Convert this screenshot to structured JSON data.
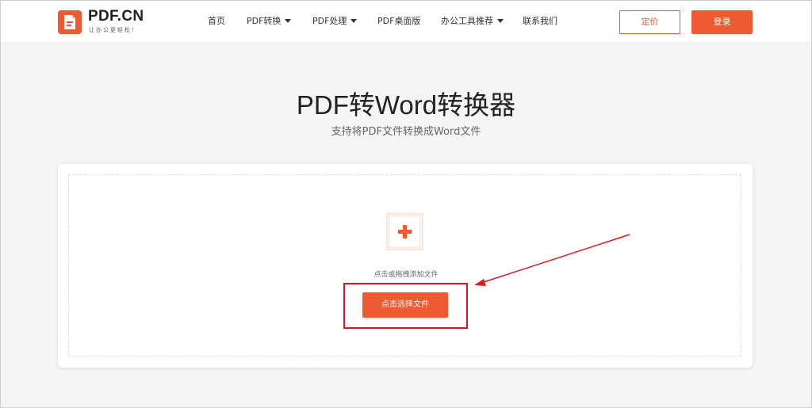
{
  "header": {
    "brand": "PDF.CN",
    "slogan": "让办公更轻松！",
    "logo_icon": "pdf-document-icon",
    "nav": [
      {
        "label": "首页",
        "has_dropdown": false
      },
      {
        "label": "PDF转换",
        "has_dropdown": true
      },
      {
        "label": "PDF处理",
        "has_dropdown": true
      },
      {
        "label": "PDF桌面版",
        "has_dropdown": false
      },
      {
        "label": "办公工具推荐",
        "has_dropdown": true
      },
      {
        "label": "联系我们",
        "has_dropdown": false
      }
    ],
    "price_button": "定价",
    "login_button": "登录"
  },
  "main": {
    "title": "PDF转Word转换器",
    "subtitle": "支持将PDF文件转换成Word文件",
    "upload": {
      "add_icon": "plus-icon",
      "hint": "点击或拖拽添加文件",
      "choose_button": "点击选择文件"
    }
  },
  "annotation": {
    "highlight_color": "#e0161c",
    "arrow_icon": "red-arrow-icon"
  },
  "colors": {
    "accent": "#ee5a32",
    "background": "#f5f5f5"
  }
}
